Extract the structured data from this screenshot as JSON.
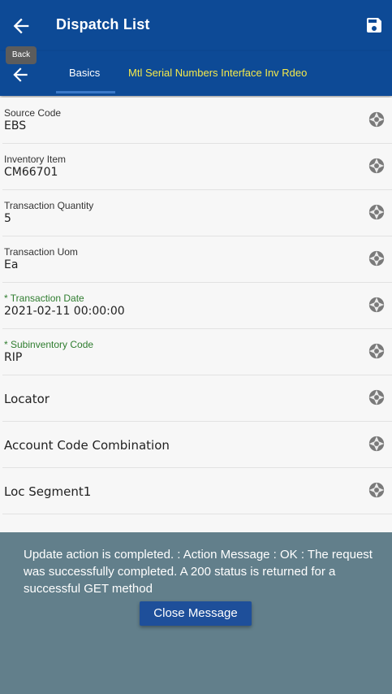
{
  "header": {
    "title": "Dispatch List",
    "back_tooltip": "Back"
  },
  "tabs": [
    {
      "label": "Basics",
      "active": true
    },
    {
      "label": "Mtl Serial Numbers Interface Inv Rdeo",
      "active": false
    }
  ],
  "fields": [
    {
      "label": "Source Code",
      "value": "EBS",
      "required": false
    },
    {
      "label": "Inventory Item",
      "value": "CM66701",
      "required": false
    },
    {
      "label": "Transaction Quantity",
      "value": "5",
      "required": false
    },
    {
      "label": "Transaction Uom",
      "value": "Ea",
      "required": false
    },
    {
      "label": "* Transaction Date",
      "value": "2021-02-11 00:00:00",
      "required": true
    },
    {
      "label": "* Subinventory Code",
      "value": "RIP",
      "required": true
    },
    {
      "label": "Locator",
      "value": "",
      "required": false
    },
    {
      "label": "Account Code Combination",
      "value": "",
      "required": false
    },
    {
      "label": "Loc Segment1",
      "value": "",
      "required": false
    }
  ],
  "message": {
    "text": "Update action is completed.  : Action Message : OK : The request was successfully completed. A 200 status is returned for a successful GET method",
    "close_label": "Close Message"
  },
  "colors": {
    "header_bg": "#0d4a96",
    "tab_active_underline": "#3a78c8",
    "tab_highlight": "#f5e94a",
    "required_label": "#2f7d2f",
    "overlay_bg": "#627f8b",
    "button_bg": "#1e4f9a"
  },
  "icons": {
    "back": "arrow-left-icon",
    "save": "floppy-disk-icon",
    "field_action": "camera-shutter-icon"
  }
}
